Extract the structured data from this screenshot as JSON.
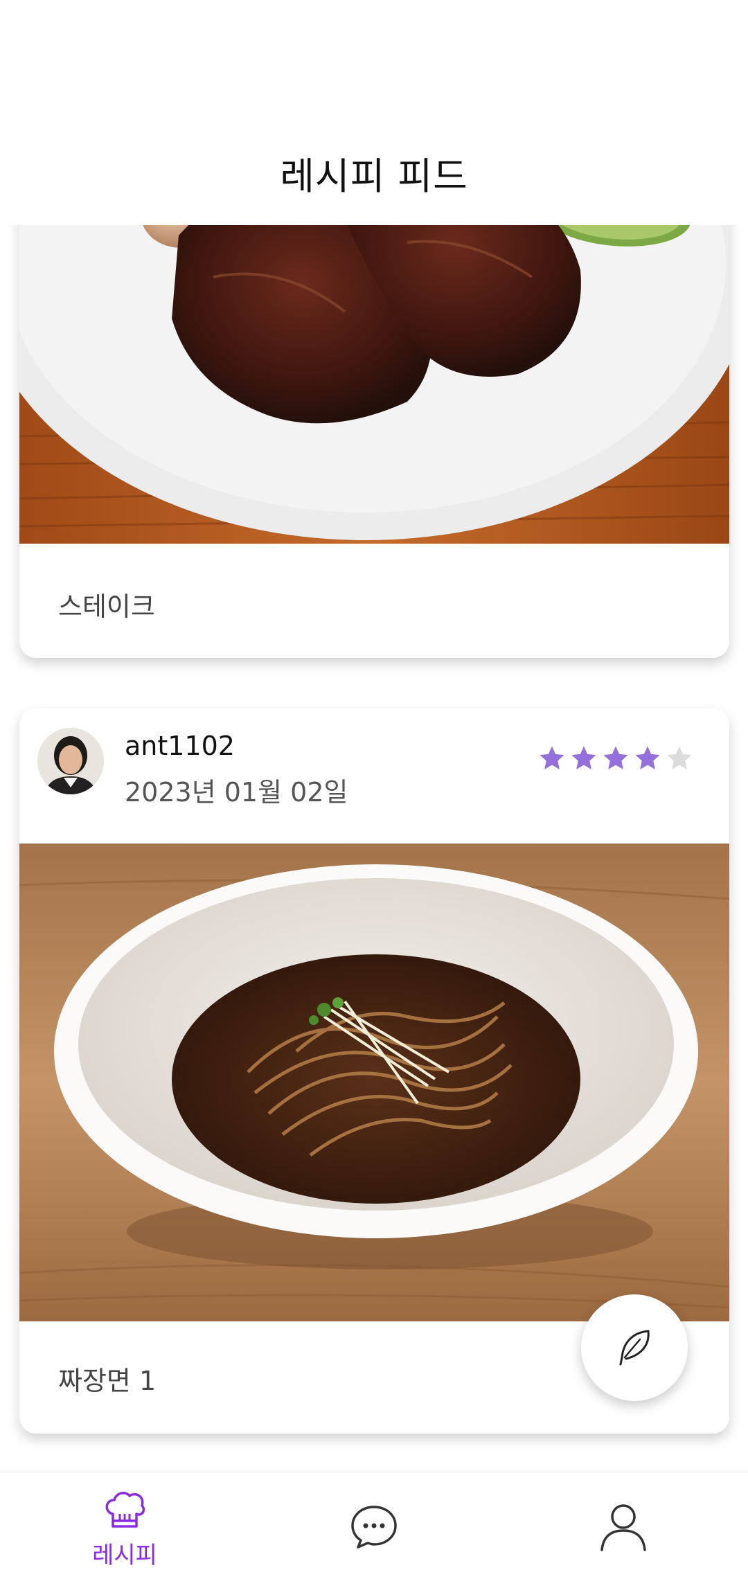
{
  "header": {
    "title": "레시피 피드"
  },
  "feed": {
    "posts": [
      {
        "caption": "스테이크"
      },
      {
        "author": "ant1102",
        "date": "2023년 01월 02일",
        "rating": 4,
        "rating_max": 5,
        "caption": "짜장면 1"
      }
    ]
  },
  "fab": {
    "icon": "feather-icon"
  },
  "bottom_nav": {
    "items": [
      {
        "icon": "chef-hat-icon",
        "label": "레시피",
        "active": true
      },
      {
        "icon": "chat-bubble-icon",
        "label": "",
        "active": false
      },
      {
        "icon": "user-icon",
        "label": "",
        "active": false
      }
    ]
  },
  "colors": {
    "accent": "#8a2be2",
    "star_filled": "#9370db",
    "star_empty": "#dcdcdc"
  }
}
